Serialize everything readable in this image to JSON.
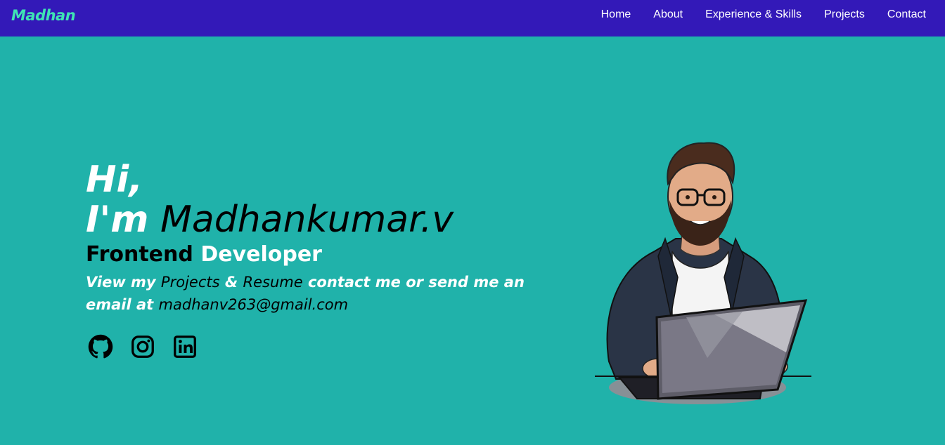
{
  "nav": {
    "logo": "Madhan",
    "links": [
      "Home",
      "About",
      "Experience & Skills",
      "Projects",
      "Contact"
    ]
  },
  "hero": {
    "greeting": "Hi,",
    "intro_prefix": "I'm",
    "name": "Madhankumar.v",
    "role_part1": "Frontend",
    "role_part2": "Developer",
    "blurb_view": "View my",
    "blurb_projects": "Projects",
    "blurb_amp": "&",
    "blurb_resume": "Resume",
    "blurb_contact": "contact me or send me an email",
    "blurb_at": "at",
    "email": "madhanv263@gmail.com"
  },
  "socials": [
    {
      "icon": "github-icon"
    },
    {
      "icon": "instagram-icon"
    },
    {
      "icon": "linkedin-icon"
    }
  ],
  "colors": {
    "background": "#20b2aa",
    "navbar": "#3319b8",
    "logo": "#3fe3b4",
    "text_light": "#ffffff",
    "text_dark": "#000000"
  }
}
